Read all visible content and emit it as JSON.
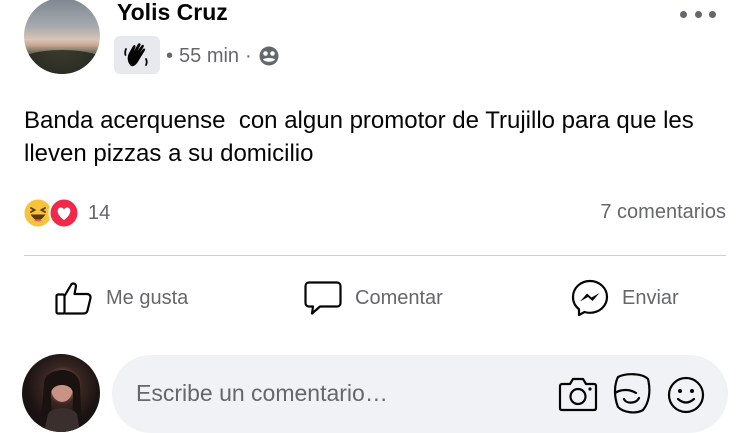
{
  "post": {
    "author": "Yolis Cruz",
    "time": "55 min",
    "audience_icon": "public-globe-icon",
    "badge_icon": "waving-hand-icon",
    "text": "Banda acerquense  con algun promotor de Trujillo para que les lleven pizzas a su domicilio",
    "reaction_icons": [
      "haha-reaction-icon",
      "love-reaction-icon"
    ],
    "reaction_count": "14",
    "comment_count": "7 comentarios"
  },
  "actions": {
    "like_label": "Me gusta",
    "comment_label": "Comentar",
    "send_label": "Enviar"
  },
  "composer": {
    "placeholder": "Escribe un comentario…"
  },
  "colors": {
    "text_primary": "#050505",
    "text_secondary": "#65676b",
    "input_background": "#f0f2f5",
    "love_red": "#f02849",
    "haha_yellow": "#f7c33b"
  }
}
